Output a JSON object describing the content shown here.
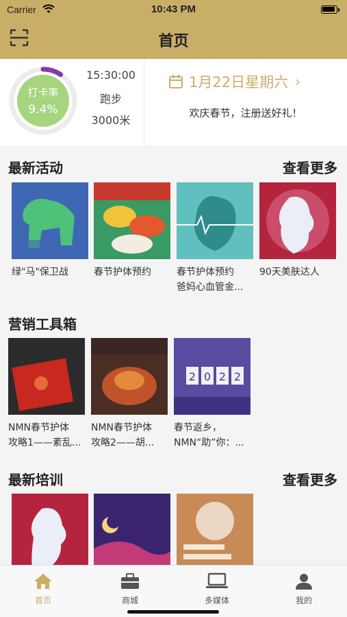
{
  "status_bar": {
    "carrier": "Carrier",
    "time": "10:43 PM"
  },
  "nav": {
    "title": "首页"
  },
  "summary": {
    "ring_label": "打卡率",
    "ring_value": "9.4%",
    "ring_progress": 0.094,
    "duration": "15:30:00",
    "activity": "跑步",
    "distance": "3000米",
    "date": "1月22日星期六",
    "promo": "欢庆春节，注册送好礼！"
  },
  "sections": {
    "activities": {
      "title": "最新活动",
      "more": "查看更多",
      "items": [
        {
          "caption": "绿\"马\"保卫战"
        },
        {
          "caption": "春节护体预约"
        },
        {
          "caption": "春节护体预约",
          "caption2": "爸妈心血管金..."
        },
        {
          "caption": "90天美肤达人"
        }
      ]
    },
    "toolbox": {
      "title": "营销工具箱",
      "items": [
        {
          "caption": "NMN春节护体",
          "caption2": "攻略1——紊乱..."
        },
        {
          "caption": "NMN春节护体",
          "caption2": "攻略2——胡..."
        },
        {
          "caption": "春节返乡，",
          "caption2": "NMN“助”你：..."
        }
      ]
    },
    "training": {
      "title": "最新培训",
      "more": "查看更多"
    }
  },
  "tabs": [
    {
      "label": "首页",
      "icon": "home-icon",
      "active": true
    },
    {
      "label": "商城",
      "icon": "briefcase-icon"
    },
    {
      "label": "多媒体",
      "icon": "laptop-icon"
    },
    {
      "label": "我的",
      "icon": "person-icon"
    }
  ],
  "colors": {
    "accent": "#c9ae67",
    "ring_fill": "#a6d47f",
    "ring_track": "#ececec",
    "ring_arc": "#8a3aa8"
  }
}
